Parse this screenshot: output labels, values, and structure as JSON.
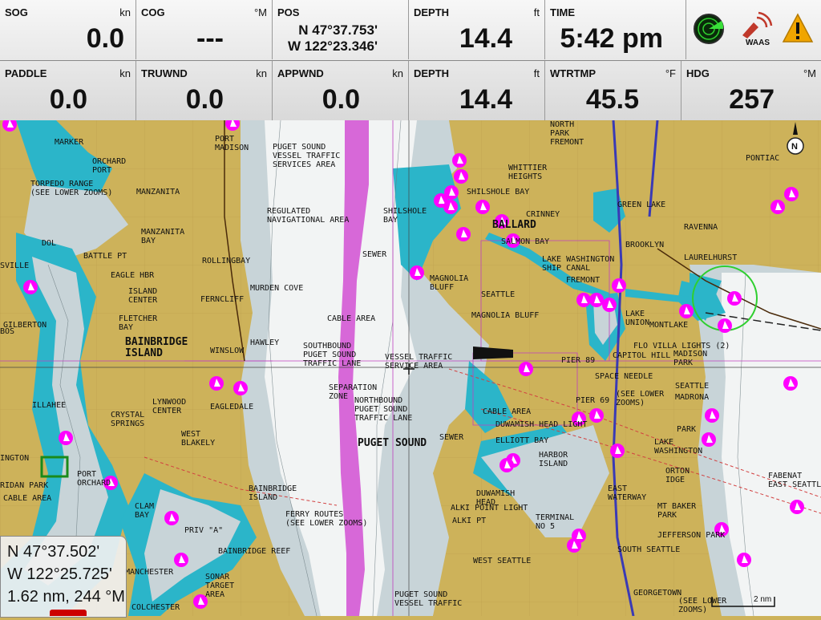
{
  "databar": {
    "row1": [
      {
        "label": "SOG",
        "unit": "kn",
        "value": "0.0"
      },
      {
        "label": "COG",
        "unit": "°M",
        "value": "---"
      },
      {
        "label": "POS",
        "unit": "",
        "lat": "N 47°37.753'",
        "lon": "W 122°23.346'"
      },
      {
        "label": "DEPTH",
        "unit": "ft",
        "value": "14.4"
      },
      {
        "label": "TIME",
        "unit": "",
        "value": "5:42 pm"
      }
    ],
    "row2": [
      {
        "label": "PADDLE",
        "unit": "kn",
        "value": "0.0"
      },
      {
        "label": "TRUWND",
        "unit": "kn",
        "value": "0.0"
      },
      {
        "label": "APPWND",
        "unit": "kn",
        "value": "0.0"
      },
      {
        "label": "DEPTH",
        "unit": "ft",
        "value": "14.4"
      },
      {
        "label": "WTRTMP",
        "unit": "°F",
        "value": "45.5"
      },
      {
        "label": "HDG",
        "unit": "°M",
        "value": "257"
      }
    ],
    "status_icons": [
      {
        "name": "radar-icon",
        "color": "#1b7d1b"
      },
      {
        "name": "gps-waas-icon",
        "color": "#c0392b",
        "text": "WAAS"
      },
      {
        "name": "warning-icon",
        "color": "#f0a500"
      }
    ]
  },
  "cursor": {
    "lat": "N 47°37.502'",
    "lon": "W 122°25.725'",
    "range": "1.62 nm, 244 °M"
  },
  "scale": {
    "label": "2 nm"
  },
  "colors": {
    "land": "#cdb25a",
    "deep_water": "#ffffff",
    "shallow_water": "#2bb5c9",
    "mid_water": "#c8d4d8",
    "traffic_lane": "#d24fd2",
    "marker": "#ff00ff"
  },
  "map_labels": {
    "marker": "MARKER",
    "orchard_port": "ORCHARD\nPORT",
    "torpedo_range": "TORPEDO RANGE\n(SEE LOWER ZOOMS)",
    "manzanita": "MANZANITA",
    "manzanita_bay": "MANZANITA\nBAY",
    "port_madison": "PORT\nMADISON",
    "puget_sound_vts": "PUGET SOUND\nVESSEL TRAFFIC\nSERVICES AREA",
    "reg_nav": "REGULATED\nNAVIGATIONAL AREA",
    "rolling_bay": "ROLLINGBAY",
    "sewer": "SEWER",
    "shilshole": "SHILSHOLE\nBAY",
    "shilshole_bay": "SHILSHOLE BAY",
    "ballard": "BALLARD",
    "salmon_bay": "SALMON BAY",
    "whittier": "WHITTIER\nHEIGHTS",
    "north_park": "NORTH\nPARK\nFREMONT",
    "crinney": "CRINNEY",
    "green_lake": "GREEN LAKE",
    "brooklyn": "BROOKLYN",
    "ravenna": "RAVENNA",
    "pontiac": "PONTIAC",
    "laurelhurst": "LAURELHURST",
    "lwsc": "LAKE WASHINGTON\nSHIP CANAL",
    "fremont": "FREMONT",
    "dol": "DOL",
    "battle_pt": "BATTLE PT",
    "eagle_hbr": "EAGLE HBR",
    "island_center": "ISLAND\nCENTER",
    "fernc": "FERNCLIFF",
    "murden": "MURDEN COVE",
    "magnolia_bluff": "MAGNOLIA\nBLUFF",
    "seattle_lbl": "SEATTLE",
    "magnolia_bluff2": "MAGNOLIA BLUFF",
    "gilberton": "GILBERTON",
    "fletcher": "FLETCHER\nBAY",
    "bainbridge": "BAINBRIDGE\nISLAND",
    "winslow": "WINSLOW",
    "hawley": "HAWLEY",
    "cable_area": "CABLE AREA",
    "southbound": "SOUTHBOUND\nPUGET SOUND\nTRAFFIC LANE",
    "vessel_traffic": "VESSEL TRAFFIC\nSERVICE AREA",
    "lake_union": "LAKE\nUNION",
    "montlake": "MONTLAKE",
    "pier_89": "PIER 89",
    "capitol_hill": "CAPITOL HILL",
    "space_needle": "SPACE NEEDLE",
    "flo_villa": "FLO VILLA LIGHTS (2)",
    "madison_park": "MADISON\nPARK",
    "illahee": "ILLAHEE",
    "crystal_springs": "CRYSTAL\nSPRINGS",
    "lynwood": "LYNWOOD\nCENTER",
    "eagledale": "EAGLEDALE",
    "sep_zone": "SEPARATION\nZONE",
    "northbound": "NORTHBOUND\nPUGET SOUND\nTRAFFIC LANE",
    "pier69": "PIER 69",
    "see_lower": "(SEE LOWER\nZOOMS)",
    "seattle_big": "SEATTLE",
    "madrona": "MADRONA",
    "west_blakely": "WEST\nBLAKELY",
    "puget_sound": "PUGET SOUND",
    "cable_area2": "CABLE AREA",
    "duwamish_head": "DUWAMISH HEAD LIGHT",
    "elliott_bay": "ELLIOTT BAY",
    "harbor_island": "HARBOR\nISLAND",
    "lake_washington": "LAKE\nWASHINGTON",
    "park": "PARK",
    "overlake": "ORTON\nIDGE",
    "port_orchard": "PORT\nORCHARD",
    "ridan_park": "RIDAN PARK",
    "cable_area3": "CABLE AREA",
    "ington": "INGTON",
    "clam_bay": "CLAM\nBAY",
    "bainbridge_island2": "BAINBRIDGE\nISLAND",
    "ferry_routes": "FERRY ROUTES\n(SEE LOWER ZOOMS)",
    "sewer2": "SEWER",
    "duwamish_head2": "DUWAMISH\nHEAD",
    "alki_point_light": "ALKI POINT LIGHT",
    "alki_pt": "ALKI PT",
    "east_waterway": "EAST\nWATERWAY",
    "terminal": "TERMINAL\nNO 5",
    "mt_baker": "MT BAKER\nPARK",
    "fabenat": "FABENAT\nEAST SEATTLE",
    "jefferson": "JEFFERSON PARK",
    "priv": "PRIV \"A\"",
    "bainbridge_reef": "BAINBRIDGE REEF",
    "manchester": "MANCHESTER",
    "sonar": "SONAR\nTARGET\nAREA",
    "west_seattle": "WEST SEATTLE",
    "south_seattle": "SOUTH SEATTLE",
    "puget_vts2": "PUGET SOUND\nVESSEL TRAFFIC",
    "georgetown": "GEORGETOWN",
    "see_lower2": "(SEE LOWER\nZOOMS)",
    "colchester": "COLCHESTER",
    "sville": "SVILLE",
    "bos": "BOS"
  }
}
